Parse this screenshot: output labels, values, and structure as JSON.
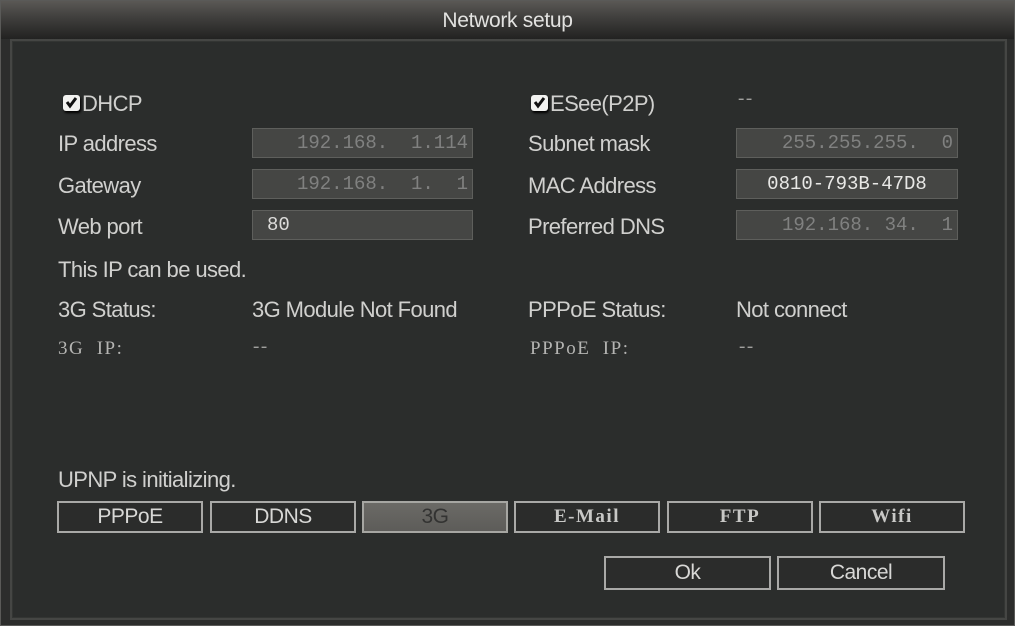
{
  "window": {
    "title": "Network setup"
  },
  "dhcp": {
    "label": "DHCP",
    "checked": true
  },
  "esee": {
    "label": "ESee(P2P)",
    "checked": true,
    "value": "--"
  },
  "fields": {
    "ip_address": {
      "label": "IP address",
      "value": "192.168.  1.114",
      "enabled": false
    },
    "gateway": {
      "label": "Gateway",
      "value": "192.168.  1.  1",
      "enabled": false
    },
    "web_port": {
      "label": "Web port",
      "value": "80",
      "enabled": true
    },
    "subnet_mask": {
      "label": "Subnet mask",
      "value": "255.255.255.  0",
      "enabled": false
    },
    "mac_address": {
      "label": "MAC Address",
      "value": "0810-793B-47D8",
      "enabled": true
    },
    "preferred_dns": {
      "label": "Preferred DNS",
      "value": "192.168. 34.  1",
      "enabled": false
    }
  },
  "ip_status_message": "This IP can be used.",
  "status": {
    "g3_status_label": "3G Status:",
    "g3_status_value": "3G Module Not Found",
    "g3_ip_label": "3G  IP:",
    "g3_ip_value": "--",
    "pppoe_status_label": "PPPoE Status:",
    "pppoe_status_value": "Not connect",
    "pppoe_ip_label": "PPPoE  IP:",
    "pppoe_ip_value": "--"
  },
  "upnp_message": "UPNP is initializing.",
  "tabs": [
    {
      "label": "PPPoE",
      "enabled": true
    },
    {
      "label": "DDNS",
      "enabled": true
    },
    {
      "label": "3G",
      "enabled": false
    },
    {
      "label": "E-Mail",
      "enabled": true
    },
    {
      "label": "FTP",
      "enabled": true
    },
    {
      "label": "Wifi",
      "enabled": true
    }
  ],
  "actions": {
    "ok_label": "Ok",
    "cancel_label": "Cancel"
  },
  "icons": {
    "checkbox": "checkmark-icon"
  }
}
